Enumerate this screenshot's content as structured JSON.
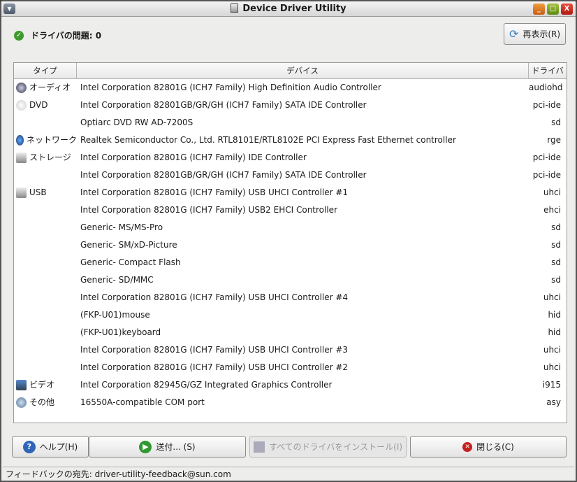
{
  "window": {
    "title": "Device Driver Utility"
  },
  "status": {
    "text": "ドライバの問題: 0"
  },
  "refresh_label": "再表示(R)",
  "table": {
    "headers": [
      "タイプ",
      "デバイス",
      "ドライバ"
    ],
    "rows": [
      {
        "type": "オーディオ",
        "icon": "audio",
        "device": "Intel Corporation 82801G (ICH7 Family) High Definition Audio Controller",
        "driver": "audiohd"
      },
      {
        "type": "DVD",
        "icon": "dvd",
        "device": "Intel Corporation 82801GB/GR/GH (ICH7 Family) SATA IDE Controller",
        "driver": "pci-ide"
      },
      {
        "type": "",
        "icon": "",
        "device": "Optiarc DVD RW AD-7200S",
        "driver": "sd"
      },
      {
        "type": "ネットワーク",
        "icon": "network",
        "device": "Realtek Semiconductor Co., Ltd. RTL8101E/RTL8102E PCI Express Fast Ethernet controller",
        "driver": "rge"
      },
      {
        "type": "ストレージ",
        "icon": "storage",
        "device": "Intel Corporation 82801G (ICH7 Family) IDE Controller",
        "driver": "pci-ide"
      },
      {
        "type": "",
        "icon": "",
        "device": "Intel Corporation 82801GB/GR/GH (ICH7 Family) SATA IDE Controller",
        "driver": "pci-ide"
      },
      {
        "type": "USB",
        "icon": "usb",
        "device": "Intel Corporation 82801G (ICH7 Family) USB UHCI Controller #1",
        "driver": "uhci"
      },
      {
        "type": "",
        "icon": "",
        "device": "Intel Corporation 82801G (ICH7 Family) USB2 EHCI Controller",
        "driver": "ehci"
      },
      {
        "type": "",
        "icon": "",
        "device": "Generic- MS/MS-Pro",
        "driver": "sd"
      },
      {
        "type": "",
        "icon": "",
        "device": "Generic- SM/xD-Picture",
        "driver": "sd"
      },
      {
        "type": "",
        "icon": "",
        "device": "Generic- Compact Flash",
        "driver": "sd"
      },
      {
        "type": "",
        "icon": "",
        "device": "Generic- SD/MMC",
        "driver": "sd"
      },
      {
        "type": "",
        "icon": "",
        "device": "Intel Corporation 82801G (ICH7 Family) USB UHCI Controller #4",
        "driver": "uhci"
      },
      {
        "type": "",
        "icon": "",
        "device": "(FKP-U01)mouse",
        "driver": "hid"
      },
      {
        "type": "",
        "icon": "",
        "device": "(FKP-U01)keyboard",
        "driver": "hid"
      },
      {
        "type": "",
        "icon": "",
        "device": "Intel Corporation 82801G (ICH7 Family) USB UHCI Controller #3",
        "driver": "uhci"
      },
      {
        "type": "",
        "icon": "",
        "device": "Intel Corporation 82801G (ICH7 Family) USB UHCI Controller #2",
        "driver": "uhci"
      },
      {
        "type": "ビデオ",
        "icon": "video",
        "device": "Intel Corporation 82945G/GZ Integrated Graphics Controller",
        "driver": "i915"
      },
      {
        "type": "その他",
        "icon": "other",
        "device": "16550A-compatible COM port",
        "driver": "asy"
      }
    ]
  },
  "buttons": {
    "help": "ヘルプ(H)",
    "submit": "送付... (S)",
    "install_all": "すべてのドライバをインストール(I)",
    "close": "閉じる(C)"
  },
  "footer": {
    "text": "フィードバックの宛先: driver-utility-feedback@sun.com"
  }
}
